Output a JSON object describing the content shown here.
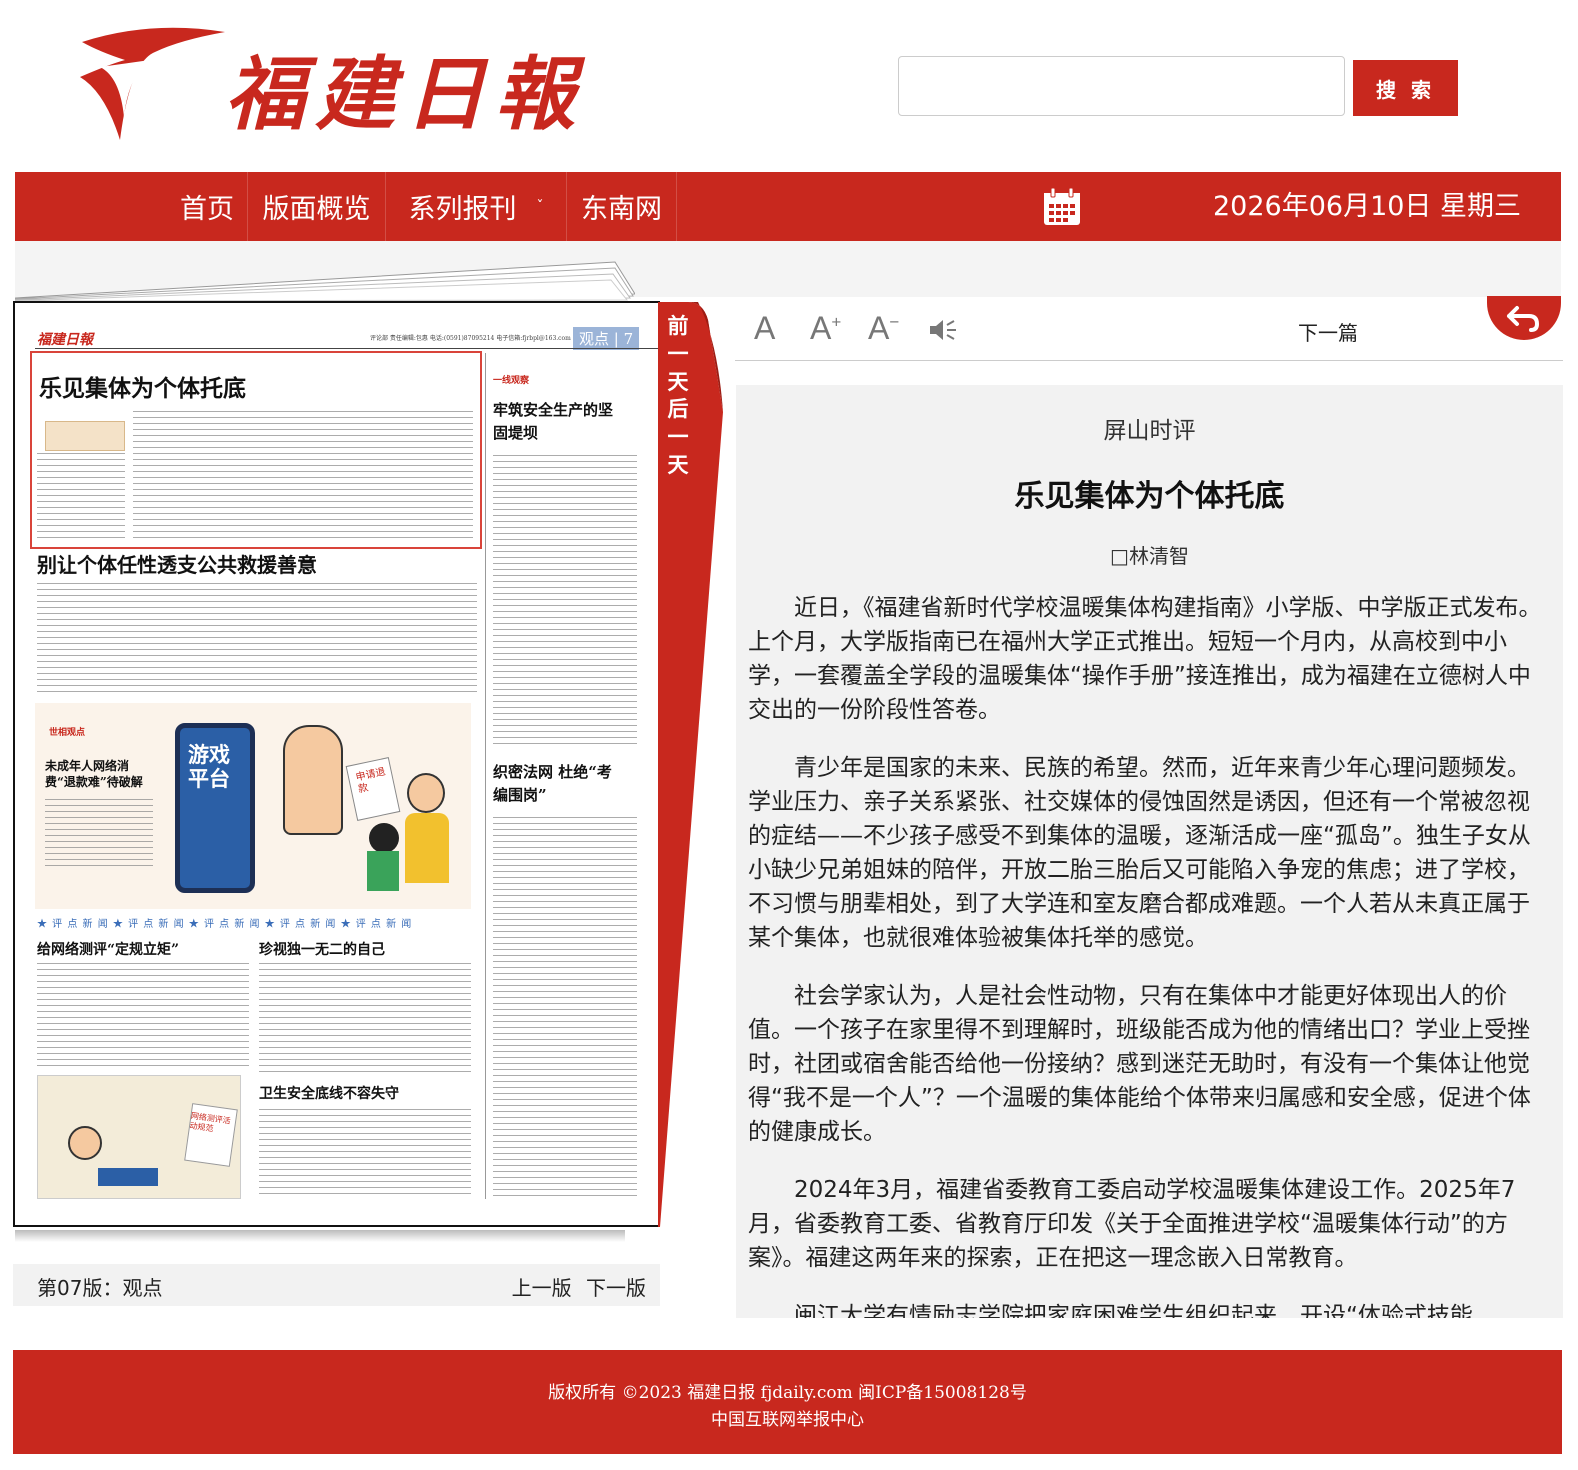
{
  "header": {
    "logo_text": "福建日報",
    "search": {
      "placeholder": "",
      "button": "搜 索"
    }
  },
  "nav": {
    "items": [
      "首页",
      "版面概览",
      "系列报刊",
      "东南网"
    ],
    "dropdown_caret": "ˇ",
    "date": "2026年06月10日 星期三"
  },
  "page_view": {
    "prev_day": "前一天",
    "next_day": "后一天",
    "page_label": "第07版：观点",
    "prev_page": "上一版",
    "next_page": "下一版",
    "thumb": {
      "section_badge": "观点 | 7",
      "header_line": "评论部  责任编辑:包惠  电话:(0591)87095214  电子信箱:fjrbpl@163.com  2026年6月10日 星期三",
      "headlines": [
        "乐见集体为个体托底",
        "别让个体任性透支公共救援善意",
        "牢筑安全生产的坚固堤坝",
        "未成年人网络消费“退款难”待破解",
        "织密法网 杜绝“考编围岗”",
        "给网络测评“定规立矩”",
        "珍视独一无二的自己",
        "卫生安全底线不容失守"
      ],
      "column_tags": [
        "一线观察",
        "世相观点",
        "★ 评 点 新 闻 ★ 评 点 新 闻 ★ 评 点 新 闻 ★ 评 点 新 闻 ★ 评 点 新 闻"
      ],
      "cartoon_text": [
        "游戏平台",
        "申请退款"
      ],
      "cartoon2_text": [
        "网络测评活动规范"
      ]
    }
  },
  "article": {
    "toolbar": {
      "font_reset": "A",
      "font_up": "A",
      "font_down": "A",
      "next": "下一篇"
    },
    "column": "屏山时评",
    "title": "乐见集体为个体托底",
    "author": "□林清智",
    "paragraphs": [
      "近日，《福建省新时代学校温暖集体构建指南》小学版、中学版正式发布。上个月，大学版指南已在福州大学正式推出。短短一个月内，从高校到中小学，一套覆盖全学段的温暖集体“操作手册”接连推出，成为福建在立德树人中交出的一份阶段性答卷。",
      "青少年是国家的未来、民族的希望。然而，近年来青少年心理问题频发。学业压力、亲子关系紧张、社交媒体的侵蚀固然是诱因，但还有一个常被忽视的症结——不少孩子感受不到集体的温暖，逐渐活成一座“孤岛”。独生子女从小缺少兄弟姐妹的陪伴，开放二胎三胎后又可能陷入争宠的焦虑；进了学校，不习惯与朋辈相处，到了大学连和室友磨合都成难题。一个人若从未真正属于某个集体，也就很难体验被集体托举的感觉。",
      "社会学家认为，人是社会性动物，只有在集体中才能更好体现出人的价值。一个孩子在家里得不到理解时，班级能否成为他的情绪出口？学业上受挫时，社团或宿舍能否给他一份接纳？感到迷茫无助时，有没有一个集体让他觉得“我不是一个人”？一个温暖的集体能给个体带来归属感和安全感，促进个体的健康成长。",
      "2024年3月，福建省委教育工委启动学校温暖集体建设工作。2025年7月，省委教育工委、省教育厅印发《关于全面推进学校“温暖集体行动”的方案》。福建这两年来的探索，正在把这一理念嵌入日常教育。",
      "闽江大学有情励志学院把家庭困难学生组织起来，开设“体验式技能"
    ]
  },
  "footer": {
    "line1": "版权所有 ©2023 福建日报 fjdaily.com 闽ICP备15008128号",
    "line2": "中国互联网举报中心"
  },
  "colors": {
    "brand_red": "#c8281e",
    "panel_gray": "#f2f2f2"
  }
}
